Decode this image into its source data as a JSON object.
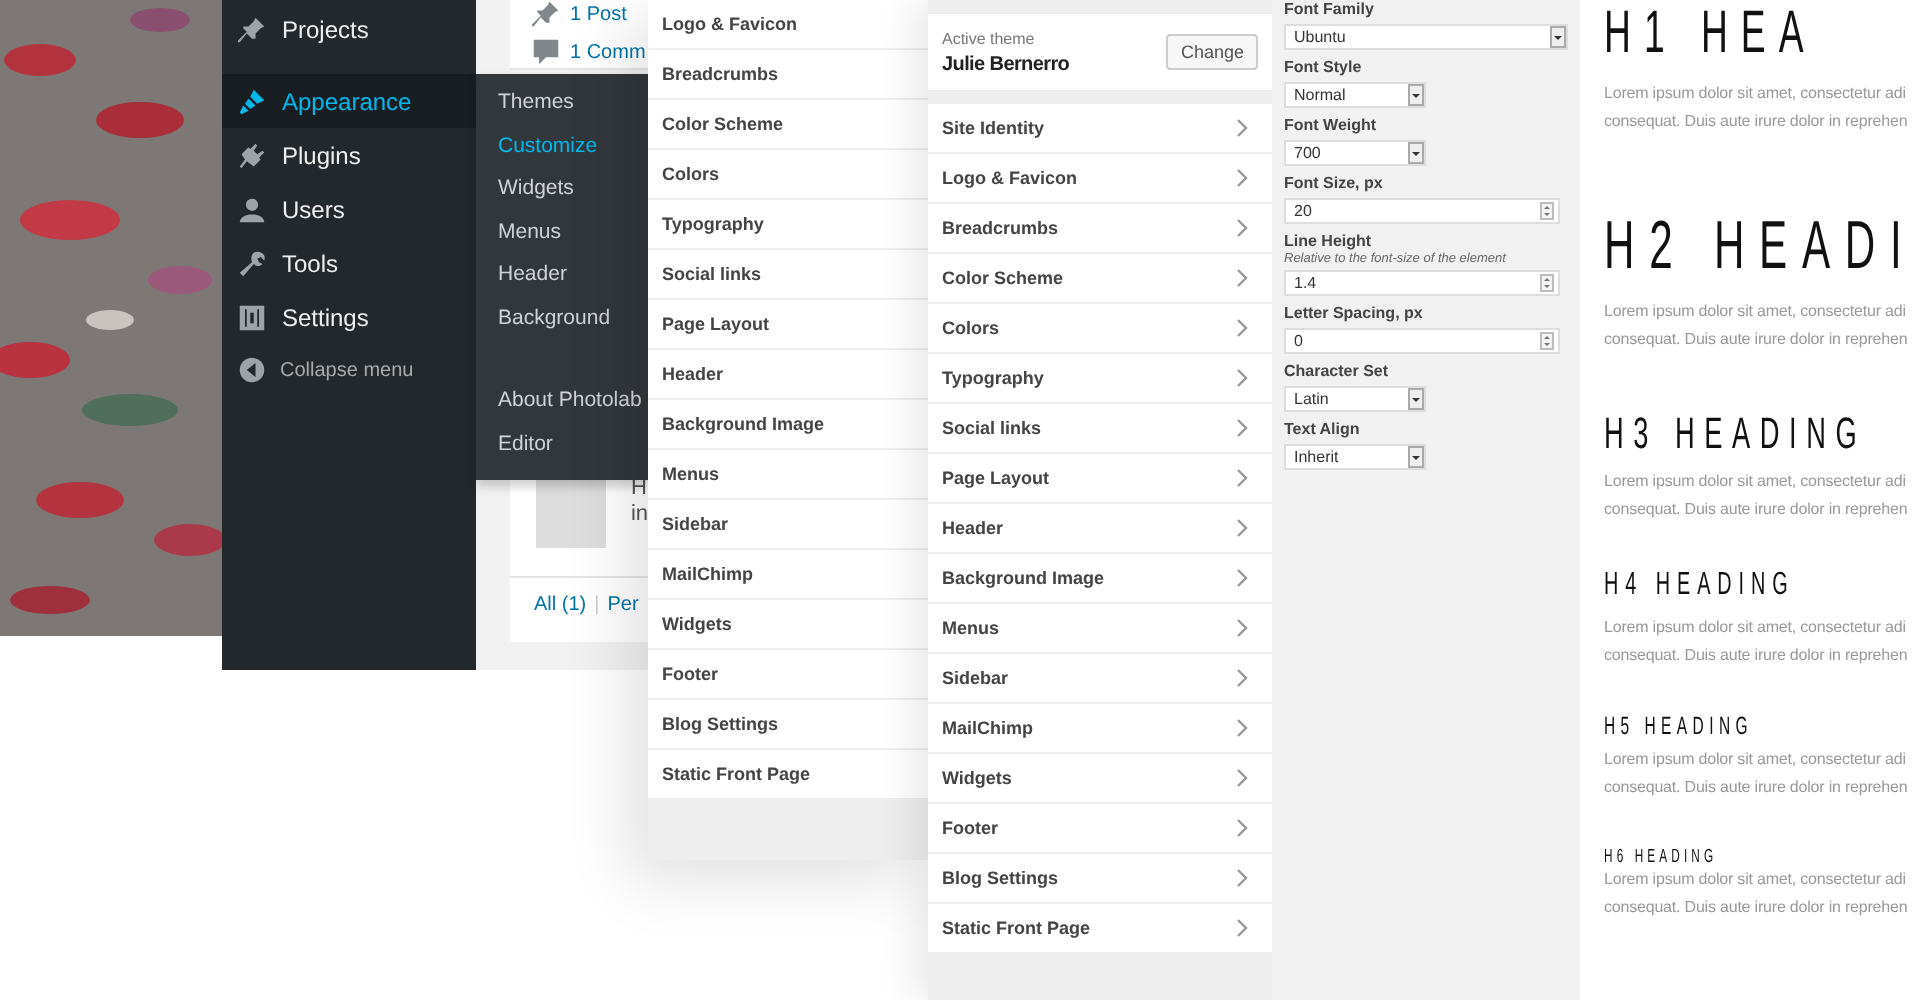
{
  "admin_menu": {
    "items": [
      {
        "label": "Projects",
        "kind": "pin",
        "selected": false
      },
      {
        "label": "Appearance",
        "kind": "brush",
        "selected": true
      },
      {
        "label": "Plugins",
        "kind": "plug",
        "selected": false
      },
      {
        "label": "Users",
        "kind": "user",
        "selected": false
      },
      {
        "label": "Tools",
        "kind": "wrench",
        "selected": false
      },
      {
        "label": "Settings",
        "kind": "sliders",
        "selected": false
      }
    ],
    "collapse": "Collapse menu"
  },
  "submenu": {
    "groups": [
      {
        "items": [
          {
            "label": "Themes",
            "selected": false
          },
          {
            "label": "Customize",
            "selected": true
          },
          {
            "label": "Widgets",
            "selected": false
          },
          {
            "label": "Menus",
            "selected": false
          },
          {
            "label": "Header",
            "selected": false
          },
          {
            "label": "Background",
            "selected": false
          }
        ]
      },
      {
        "items": [
          {
            "label": "About Photolab",
            "selected": false
          },
          {
            "label": "Editor",
            "selected": false
          }
        ]
      }
    ]
  },
  "dashboard": {
    "counts": [
      {
        "kind": "pin",
        "text": "1 Post"
      },
      {
        "kind": "comment",
        "text": "1 Comm"
      }
    ],
    "comment_lines": [
      "H",
      "in"
    ],
    "filters": [
      {
        "kind": "link",
        "text": "All (1)"
      },
      {
        "kind": "separator",
        "text": "|"
      },
      {
        "kind": "link",
        "text": "Per"
      }
    ]
  },
  "customizer_back": {
    "sections": [
      "Logo & Favicon",
      "Breadcrumbs",
      "Color Scheme",
      "Colors",
      "Typography",
      "Social links",
      "Page Layout",
      "Header",
      "Background Image",
      "Menus",
      "Sidebar",
      "MailChimp",
      "Widgets",
      "Footer",
      "Blog Settings",
      "Static Front Page"
    ]
  },
  "customizer": {
    "active_theme": {
      "label": "Active theme",
      "name": "Julie Bernerro",
      "button": "Change"
    },
    "sections": [
      "Site Identity",
      "Logo & Favicon",
      "Breadcrumbs",
      "Color Scheme",
      "Colors",
      "Typography",
      "Social links",
      "Page Layout",
      "Header",
      "Background Image",
      "Menus",
      "Sidebar",
      "MailChimp",
      "Widgets",
      "Footer",
      "Blog Settings",
      "Static Front Page"
    ]
  },
  "typography_controls": [
    {
      "label": "Font Family",
      "kind": "wide_select",
      "value": "Ubuntu"
    },
    {
      "label": "Font Style",
      "kind": "select",
      "value": "Normal"
    },
    {
      "label": "Font Weight",
      "kind": "select",
      "value": "700"
    },
    {
      "label": "Font Size, px",
      "kind": "number",
      "value": "20"
    },
    {
      "label": "Line Height",
      "hint": "Relative to the font-size of the element",
      "kind": "number",
      "value": "1.4"
    },
    {
      "label": "Letter Spacing, px",
      "kind": "number",
      "value": "0"
    },
    {
      "label": "Character Set",
      "kind": "select",
      "value": "Latin"
    },
    {
      "label": "Text Align",
      "kind": "select",
      "value": "Inherit"
    }
  ],
  "preview": {
    "headings": [
      {
        "kind": "h1",
        "text": "H1 HEA",
        "body": [
          "Lorem ipsum dolor sit amet, consectetur adi",
          "consequat. Duis aute irure dolor in reprehen"
        ]
      },
      {
        "kind": "h2",
        "text": "H2 HEADI",
        "body": [
          "Lorem ipsum dolor sit amet, consectetur adi",
          "consequat. Duis aute irure dolor in reprehen"
        ]
      },
      {
        "kind": "h3",
        "text": "H3 HEADING",
        "body": [
          "Lorem ipsum dolor sit amet, consectetur adi",
          "consequat. Duis aute irure dolor in reprehen"
        ]
      },
      {
        "kind": "h4",
        "text": "H4 HEADING",
        "body": [
          "Lorem ipsum dolor sit amet, consectetur adi",
          "consequat. Duis aute irure dolor in reprehen"
        ]
      },
      {
        "kind": "h5",
        "text": "H5 HEADING",
        "body": [
          "Lorem ipsum dolor sit amet, consectetur adi",
          "consequat. Duis aute irure dolor in reprehen"
        ]
      },
      {
        "kind": "h6",
        "text": "H6 HEADING",
        "body": [
          "Lorem ipsum dolor sit amet, consectetur adi",
          "consequat. Duis aute irure dolor in reprehen"
        ]
      }
    ]
  }
}
